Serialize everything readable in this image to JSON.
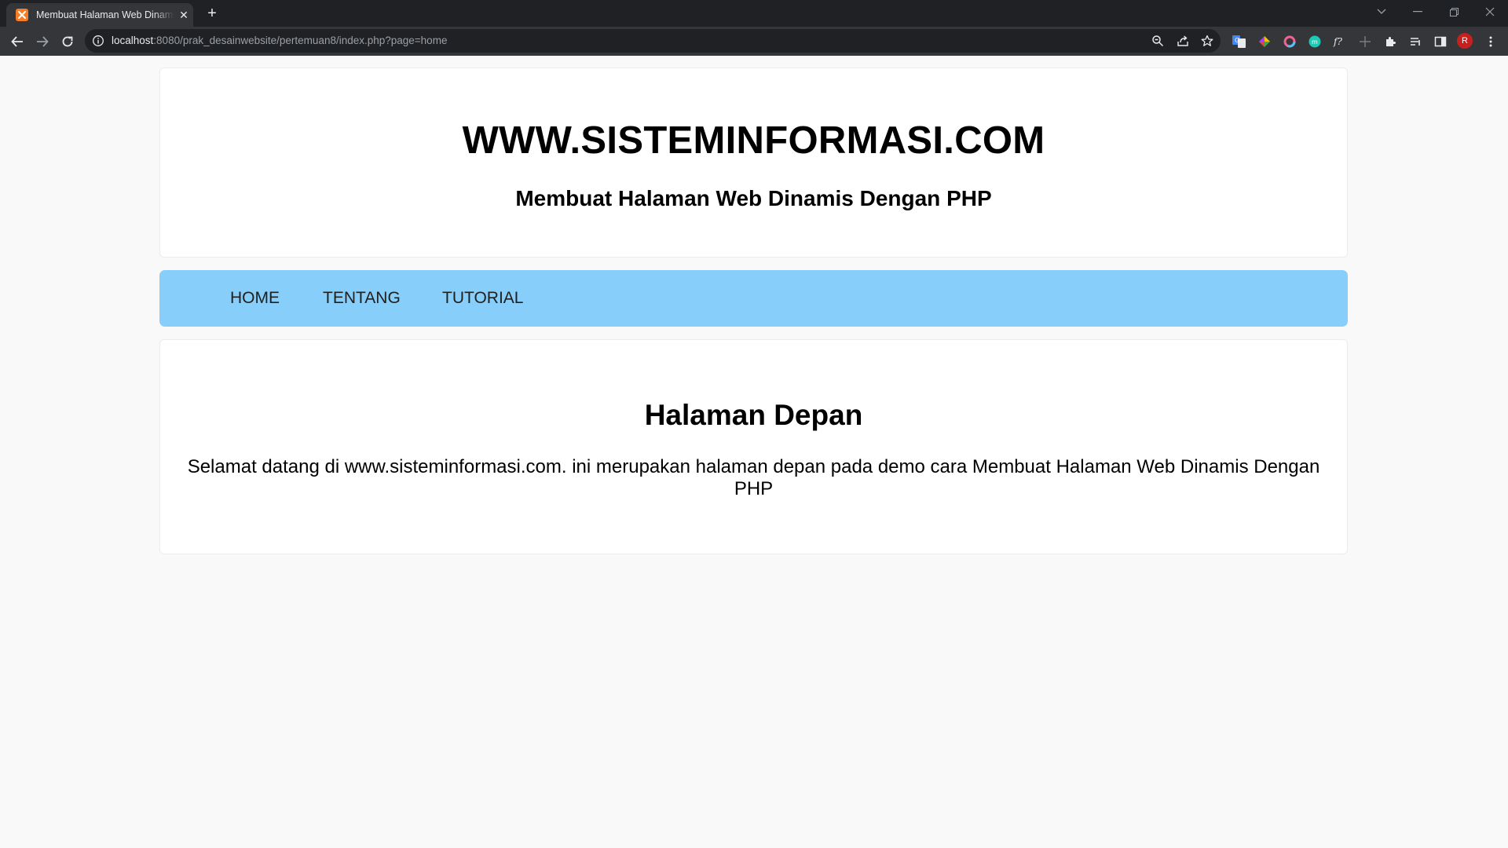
{
  "browser": {
    "tab_title": "Membuat Halaman Web Dinamis Dengan PHP",
    "url_host": "localhost",
    "url_rest": ":8080/prak_desainwebsite/pertemuan8/index.php?page=home",
    "profile_initial": "R",
    "tab_close_glyph": "✕",
    "new_tab_glyph": "+"
  },
  "header": {
    "site_title": "WWW.SISTEMINFORMASI.COM",
    "site_subtitle": "Membuat Halaman Web Dinamis Dengan PHP"
  },
  "nav": {
    "items": [
      {
        "label": "HOME"
      },
      {
        "label": "TENTANG"
      },
      {
        "label": "TUTORIAL"
      }
    ]
  },
  "content": {
    "title": "Halaman Depan",
    "text": "Selamat datang di www.sisteminformasi.com. ini merupakan halaman depan pada demo cara Membuat Halaman Web Dinamis Dengan PHP"
  },
  "colors": {
    "page_background": "#f9f9f9",
    "card_background": "#ffffff",
    "nav_background": "#87cefa",
    "browser_dark": "#202124",
    "browser_toolbar": "#35363a"
  }
}
